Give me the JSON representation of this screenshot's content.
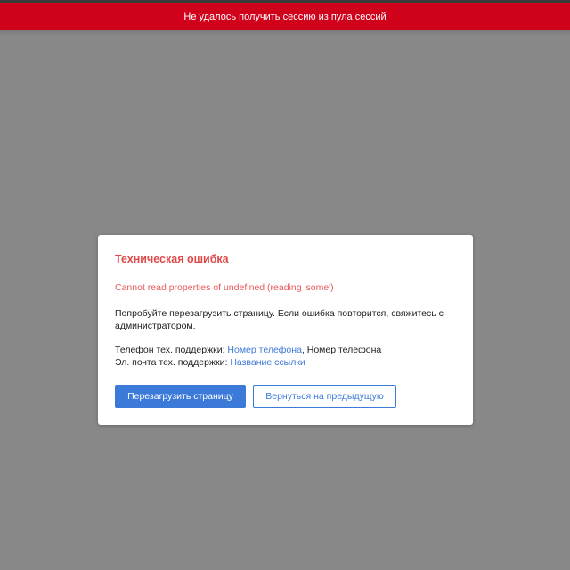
{
  "banner": {
    "message": "Не удалось получить сессию из пула сессий"
  },
  "dialog": {
    "title": "Техническая ошибка",
    "error_message": "Cannot read properties of undefined (reading 'some')",
    "hint": "Попробуйте перезагрузить страницу. Если ошибка повторится, свяжитесь с администратором.",
    "phone": {
      "label": "Телефон тех. поддержки: ",
      "link_text": "Номер телефона",
      "suffix": ", Номер телефона"
    },
    "email": {
      "label": "Эл. почта тех. поддержки: ",
      "link_text": "Название ссылки"
    },
    "buttons": {
      "reload": "Перезагрузить страницу",
      "back": "Вернуться на предыдущую"
    }
  },
  "colors": {
    "banner_bg": "#d0021b",
    "overlay_bg": "#888888",
    "title": "#e04848",
    "error_text": "#e75a5a",
    "accent": "#3c7ad9"
  }
}
